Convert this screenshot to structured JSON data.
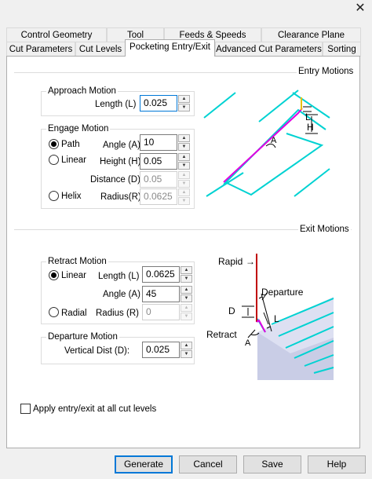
{
  "window": {
    "close_glyph": "✕"
  },
  "tabs_row1": [
    "Control Geometry",
    "Tool",
    "Feeds & Speeds",
    "Clearance Plane"
  ],
  "tabs_row2": [
    "Cut Parameters",
    "Cut Levels",
    "Pocketing Entry/Exit",
    "Advanced Cut Parameters",
    "Sorting"
  ],
  "active_tab": "Pocketing Entry/Exit",
  "entry_motions": {
    "title": "Entry Motions",
    "approach": {
      "title": "Approach Motion",
      "length_label": "Length (L)",
      "length_value": "0.025"
    },
    "engage": {
      "title": "Engage Motion",
      "selected": "Path",
      "path_label": "Path",
      "linear_label": "Linear",
      "helix_label": "Helix",
      "angle_label": "Angle (A)",
      "angle_value": "10",
      "height_label": "Height (H)",
      "height_value": "0.05",
      "distance_label": "Distance (D)",
      "distance_value": "0.05",
      "radius_label": "Radius(R)",
      "radius_value": "0.0625"
    },
    "diagram": {
      "label_l": "L",
      "label_h": "H",
      "label_a": "A"
    }
  },
  "exit_motions": {
    "title": "Exit Motions",
    "retract": {
      "title": "Retract Motion",
      "selected": "Linear",
      "linear_label": "Linear",
      "radial_label": "Radial",
      "length_label": "Length (L)",
      "length_value": "0.0625",
      "angle_label": "Angle (A)",
      "angle_value": "45",
      "radius_label": "Radius (R)",
      "radius_value": "0"
    },
    "departure": {
      "title": "Departure Motion",
      "vertical_label": "Vertical Dist (D):",
      "vertical_value": "0.025"
    },
    "diagram": {
      "rapid_label": "Rapid",
      "departure_label": "Departure",
      "retract_label": "Retract",
      "label_d": "D",
      "label_l": "L",
      "label_a": "A"
    }
  },
  "apply_all_levels": {
    "label": "Apply entry/exit at all cut levels",
    "checked": false
  },
  "buttons": {
    "generate": "Generate",
    "cancel": "Cancel",
    "save": "Save",
    "help": "Help"
  },
  "icons": {
    "spin_up": "▲",
    "spin_down": "▼",
    "arrow": "→"
  },
  "colors": {
    "accent": "#0078d7",
    "toolpath_cyan": "#00d2d2",
    "path_magenta": "#e000e0",
    "rapid_red": "#c00000",
    "tool_yellow": "#e8c000"
  }
}
